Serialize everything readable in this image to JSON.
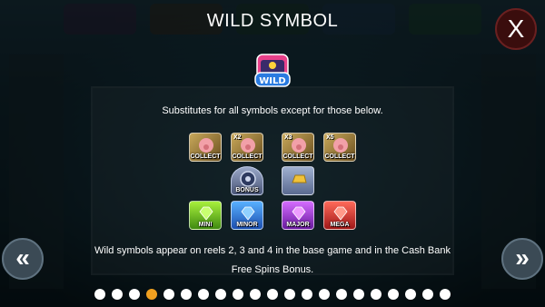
{
  "page": {
    "title": "WILD SYMBOL",
    "close_label": "X",
    "wild_logo_label": "WILD",
    "description": "Substitutes for all symbols except for those below.",
    "body": "Wild symbols appear on reels 2, 3 and 4 in the base game and in the Cash Bank Free Spins Bonus.",
    "prev_label": "«",
    "next_label": "»"
  },
  "symbols": {
    "row1": [
      {
        "label": "COLLECT",
        "mult": ""
      },
      {
        "label": "COLLECT",
        "mult": "X2"
      },
      {
        "label": "COLLECT",
        "mult": "X3"
      },
      {
        "label": "COLLECT",
        "mult": "X5"
      }
    ],
    "row2": [
      {
        "label": "BONUS"
      },
      {
        "label": ""
      }
    ],
    "row3": [
      {
        "label": "MINI"
      },
      {
        "label": "MINOR"
      },
      {
        "label": "MAJOR"
      },
      {
        "label": "MEGA"
      }
    ]
  },
  "pagination": {
    "total": 21,
    "active": 4
  },
  "colors": {
    "accent_dot": "#f0a020",
    "close_bg": "#3a0d0d"
  }
}
